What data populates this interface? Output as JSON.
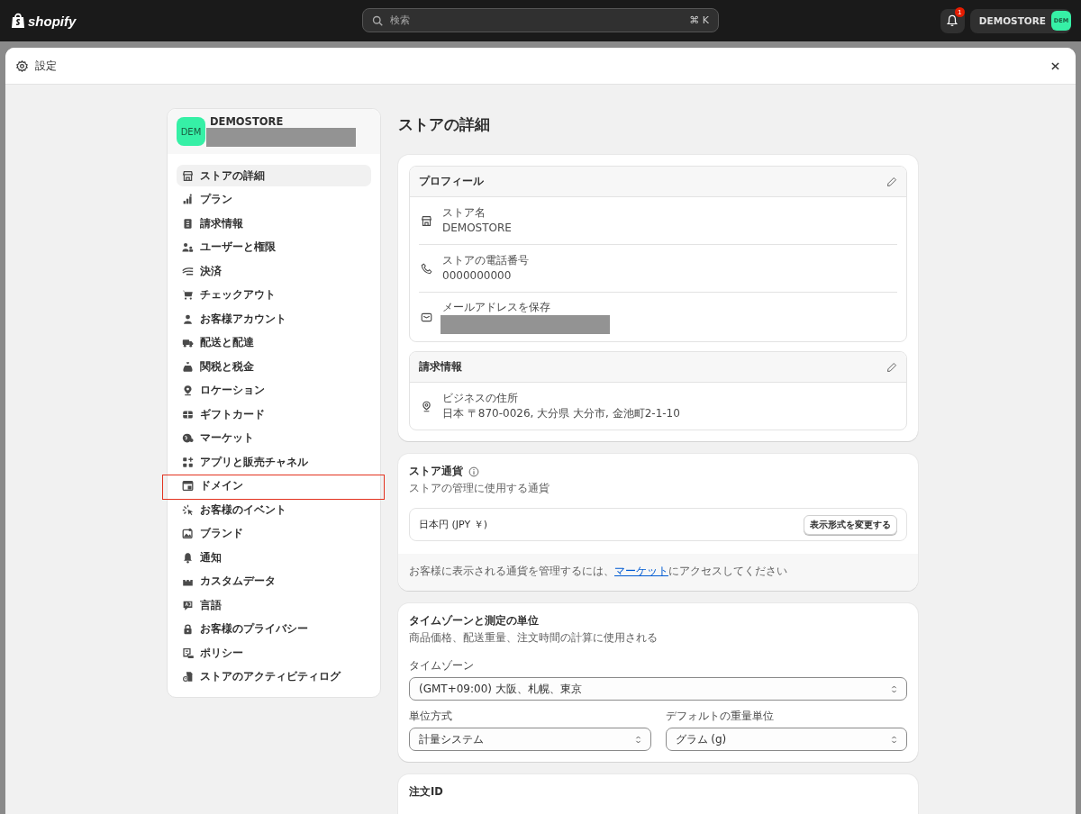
{
  "topbar": {
    "logo": "shopify",
    "search": {
      "placeholder": "検索",
      "shortcut": "⌘ K"
    },
    "notifications": {
      "badge": "1"
    },
    "store": {
      "name": "DEMOSTORE",
      "avatar": "DEM"
    }
  },
  "window": {
    "title": "設定"
  },
  "sidebar": {
    "store": {
      "avatar": "DEM",
      "name": "DEMOSTORE",
      "subtitle_redacted": true
    },
    "items": [
      {
        "label": "ストアの詳細",
        "selected": true,
        "highlighted": false
      },
      {
        "label": "プラン",
        "selected": false,
        "highlighted": false
      },
      {
        "label": "請求情報",
        "selected": false,
        "highlighted": false
      },
      {
        "label": "ユーザーと権限",
        "selected": false,
        "highlighted": false
      },
      {
        "label": "決済",
        "selected": false,
        "highlighted": false
      },
      {
        "label": "チェックアウト",
        "selected": false,
        "highlighted": false
      },
      {
        "label": "お客様アカウント",
        "selected": false,
        "highlighted": false
      },
      {
        "label": "配送と配達",
        "selected": false,
        "highlighted": false
      },
      {
        "label": "関税と税金",
        "selected": false,
        "highlighted": false
      },
      {
        "label": "ロケーション",
        "selected": false,
        "highlighted": false
      },
      {
        "label": "ギフトカード",
        "selected": false,
        "highlighted": false
      },
      {
        "label": "マーケット",
        "selected": false,
        "highlighted": false
      },
      {
        "label": "アプリと販売チャネル",
        "selected": false,
        "highlighted": false
      },
      {
        "label": "ドメイン",
        "selected": false,
        "highlighted": true
      },
      {
        "label": "お客様のイベント",
        "selected": false,
        "highlighted": false
      },
      {
        "label": "ブランド",
        "selected": false,
        "highlighted": false
      },
      {
        "label": "通知",
        "selected": false,
        "highlighted": false
      },
      {
        "label": "カスタムデータ",
        "selected": false,
        "highlighted": false
      },
      {
        "label": "言語",
        "selected": false,
        "highlighted": false
      },
      {
        "label": "お客様のプライバシー",
        "selected": false,
        "highlighted": false
      },
      {
        "label": "ポリシー",
        "selected": false,
        "highlighted": false
      },
      {
        "label": "ストアのアクティビティログ",
        "selected": false,
        "highlighted": false
      }
    ]
  },
  "page": {
    "title": "ストアの詳細"
  },
  "profile": {
    "title": "プロフィール",
    "fields": [
      {
        "label": "ストア名",
        "value": "DEMOSTORE"
      },
      {
        "label": "ストアの電話番号",
        "value": "0000000000"
      },
      {
        "label": "メールアドレスを保存",
        "redacted": true
      }
    ]
  },
  "billing": {
    "title": "請求情報",
    "fields": [
      {
        "label": "ビジネスの住所",
        "value": "日本 〒870-0026, 大分県 大分市, 金池町2-1-10"
      }
    ]
  },
  "currency": {
    "title": "ストア通貨",
    "subtitle": "ストアの管理に使用する通貨",
    "value": "日本円 (JPY ￥)",
    "button": "表示形式を変更する",
    "note_before": "お客様に表示される通貨を管理するには、",
    "note_link": "マーケット",
    "note_after": "にアクセスしてください"
  },
  "timezone": {
    "title": "タイムゾーンと測定の単位",
    "subtitle": "商品価格、配送重量、注文時間の計算に使用される",
    "timezone_label": "タイムゾーン",
    "timezone_value": "(GMT+09:00) 大阪、札幌、東京",
    "unit_system_label": "単位方式",
    "unit_system_value": "計量システム",
    "weight_label": "デフォルトの重量単位",
    "weight_value": "グラム (g)"
  },
  "order_id": {
    "title": "注文ID"
  }
}
